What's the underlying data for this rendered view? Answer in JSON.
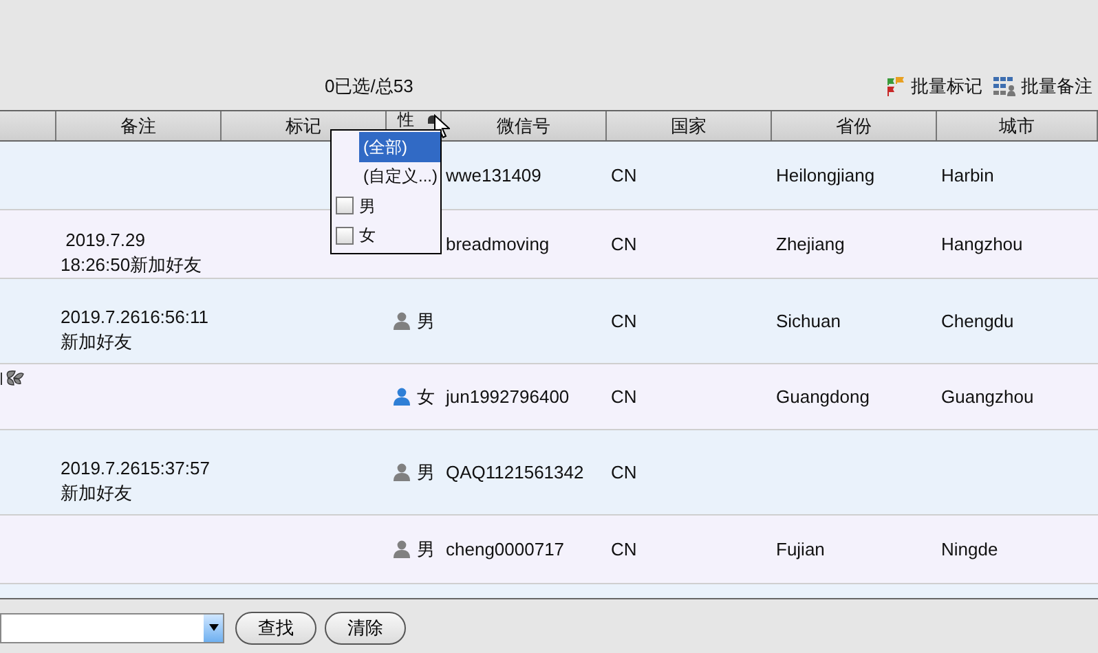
{
  "selection_count": "0已选/总53",
  "toolbar": [
    {
      "label": "批量标记",
      "kind": "flag"
    },
    {
      "label": "批量备注",
      "kind": "grid"
    }
  ],
  "table": {
    "columns": [
      "",
      "备注",
      "标记",
      "性",
      "微信号",
      "国家",
      "省份",
      "城市"
    ],
    "rows": [
      {
        "remark": [],
        "sex": null,
        "wechat": "wwe131409",
        "country": "CN",
        "province": "Heilongjiang",
        "city": "Harbin"
      },
      {
        "remark": [
          " 2019.7.29",
          "18:26:50新加好友"
        ],
        "sex": null,
        "wechat": "breadmoving",
        "country": "CN",
        "province": "Zhejiang",
        "city": "Hangzhou"
      },
      {
        "remark": [
          "2019.7.2616:56:11",
          "新加好友"
        ],
        "sex": {
          "label": "男",
          "kind": "male"
        },
        "wechat": "",
        "country": "CN",
        "province": "Sichuan",
        "city": "Chengdu"
      },
      {
        "icon": true,
        "remark": [],
        "sex": {
          "label": "女",
          "kind": "female"
        },
        "wechat": "jun1992796400",
        "country": "CN",
        "province": "Guangdong",
        "city": "Guangzhou"
      },
      {
        "remark": [
          "2019.7.2615:37:57",
          "新加好友"
        ],
        "sex": {
          "label": "男",
          "kind": "male"
        },
        "wechat": "QAQ1121561342",
        "country": "CN",
        "province": "",
        "city": ""
      },
      {
        "remark": [],
        "sex": {
          "label": "男",
          "kind": "male"
        },
        "wechat": "cheng0000717",
        "country": "CN",
        "province": "Fujian",
        "city": "Ningde"
      }
    ]
  },
  "filter_menu": {
    "items": [
      {
        "label": "(全部)",
        "kind": "option",
        "selected": true
      },
      {
        "label": "(自定义...)",
        "kind": "option",
        "selected": false
      },
      {
        "label": "男",
        "kind": "checkbox",
        "checked": false,
        "selected": false
      },
      {
        "label": "女",
        "kind": "checkbox",
        "checked": false,
        "selected": false
      }
    ]
  },
  "buttons": [
    "查找",
    "清除"
  ]
}
